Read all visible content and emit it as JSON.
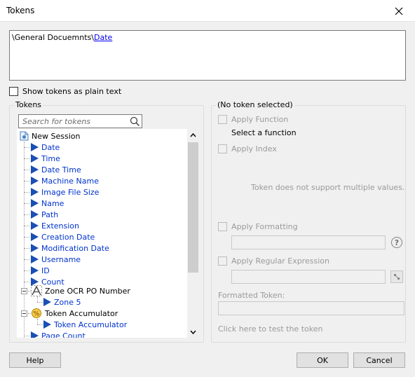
{
  "window": {
    "title": "Tokens"
  },
  "path": {
    "prefix": "\\General Docuemnts\\",
    "link": "Date"
  },
  "options": {
    "show_plain_label": "Show tokens as plain text"
  },
  "tokens_panel": {
    "legend": "Tokens",
    "search_placeholder": "Search for tokens",
    "root": "New Session",
    "items": [
      "Date",
      "Time",
      "Date Time",
      "Machine Name",
      "Image File Size",
      "Name",
      "Path",
      "Extension",
      "Creation Date",
      "Modification Date",
      "Username",
      "ID",
      "Count"
    ],
    "zone_group": "Zone OCR PO Number",
    "zone_child": "Zone 5",
    "accumulator_group": "Token Accumulator",
    "accumulator_child": "Token Accumulator",
    "last_partial": "Page Count"
  },
  "details_panel": {
    "legend": "(No token selected)",
    "apply_function": "Apply Function",
    "select_function": "Select a function",
    "apply_index": "Apply Index",
    "multi_note": "Token does not support multiple values.",
    "apply_formatting": "Apply Formatting",
    "apply_regex": "Apply Regular Expression",
    "formatted_token": "Formatted Token:",
    "test_link": "Click here to test the token",
    "help_glyph": "?"
  },
  "buttons": {
    "help": "Help",
    "ok": "OK",
    "cancel": "Cancel"
  }
}
